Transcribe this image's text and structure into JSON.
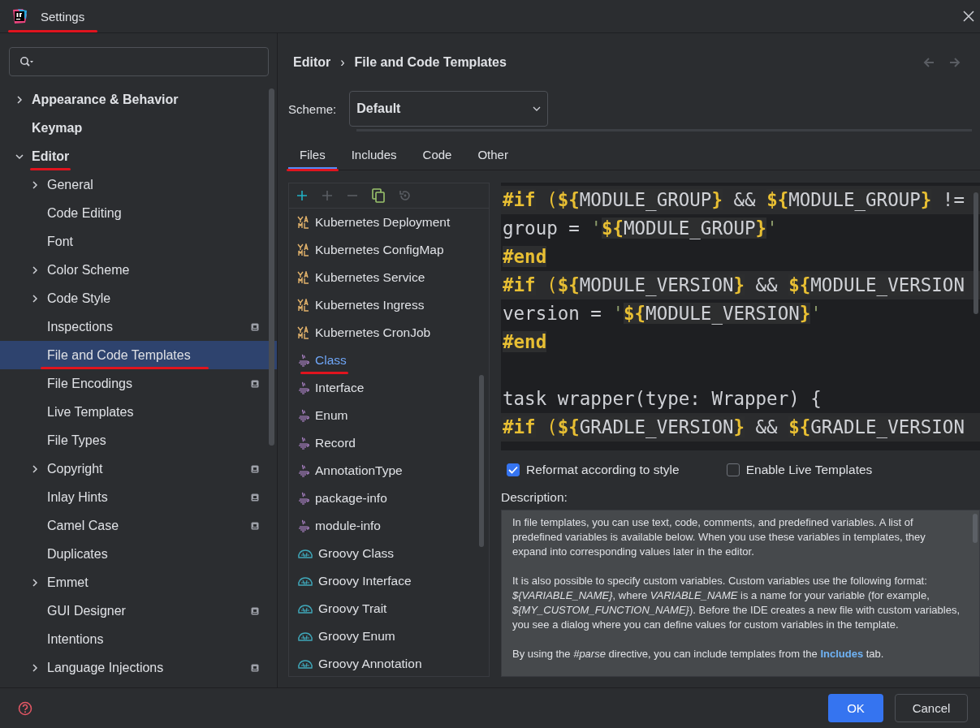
{
  "window": {
    "title": "Settings",
    "title_annotated": true
  },
  "sidebar": {
    "items": [
      {
        "label": "Appearance & Behavior",
        "expanded": false,
        "selected": false
      },
      {
        "label": "Keymap",
        "selected": false
      },
      {
        "label": "Editor",
        "expanded": true,
        "selected": false,
        "annotated": true,
        "children": [
          {
            "label": "General",
            "expanded": false,
            "selected": false
          },
          {
            "label": "Code Editing",
            "selected": false
          },
          {
            "label": "Font",
            "selected": false
          },
          {
            "label": "Color Scheme",
            "expanded": false,
            "selected": false
          },
          {
            "label": "Code Style",
            "expanded": false,
            "selected": false
          },
          {
            "label": "Inspections",
            "selected": false,
            "scoped": true
          },
          {
            "label": "File and Code Templates",
            "selected": true,
            "annotated": true
          },
          {
            "label": "File Encodings",
            "selected": false,
            "scoped": true
          },
          {
            "label": "Live Templates",
            "selected": false
          },
          {
            "label": "File Types",
            "selected": false
          },
          {
            "label": "Copyright",
            "expanded": false,
            "selected": false,
            "scoped": true
          },
          {
            "label": "Inlay Hints",
            "selected": false,
            "scoped": true
          },
          {
            "label": "Camel Case",
            "selected": false,
            "scoped": true
          },
          {
            "label": "Duplicates",
            "selected": false
          },
          {
            "label": "Emmet",
            "expanded": false,
            "selected": false
          },
          {
            "label": "GUI Designer",
            "selected": false,
            "scoped": true
          },
          {
            "label": "Intentions",
            "selected": false
          },
          {
            "label": "Language Injections",
            "expanded": false,
            "selected": false,
            "scoped": true
          }
        ]
      }
    ]
  },
  "breadcrumb": {
    "parent": "Editor",
    "separator": "›",
    "current": "File and Code Templates"
  },
  "scheme": {
    "label": "Scheme:",
    "value": "Default"
  },
  "tabs": [
    {
      "label": "Files",
      "selected": true,
      "annotated": true
    },
    {
      "label": "Includes",
      "selected": false
    },
    {
      "label": "Code",
      "selected": false
    },
    {
      "label": "Other",
      "selected": false
    }
  ],
  "templates": [
    {
      "label": "Kubernetes Deployment",
      "kind": "yaml",
      "selected": false
    },
    {
      "label": "Kubernetes ConfigMap",
      "kind": "yaml",
      "selected": false
    },
    {
      "label": "Kubernetes Service",
      "kind": "yaml",
      "selected": false
    },
    {
      "label": "Kubernetes Ingress",
      "kind": "yaml",
      "selected": false
    },
    {
      "label": "Kubernetes CronJob",
      "kind": "yaml",
      "selected": false
    },
    {
      "label": "Class",
      "kind": "java",
      "selected": true,
      "annotated": true
    },
    {
      "label": "Interface",
      "kind": "java",
      "selected": false
    },
    {
      "label": "Enum",
      "kind": "java",
      "selected": false
    },
    {
      "label": "Record",
      "kind": "java",
      "selected": false
    },
    {
      "label": "AnnotationType",
      "kind": "java",
      "selected": false
    },
    {
      "label": "package-info",
      "kind": "java",
      "selected": false
    },
    {
      "label": "module-info",
      "kind": "java",
      "selected": false
    },
    {
      "label": "Groovy Class",
      "kind": "groovy",
      "selected": false
    },
    {
      "label": "Groovy Interface",
      "kind": "groovy",
      "selected": false
    },
    {
      "label": "Groovy Trait",
      "kind": "groovy",
      "selected": false
    },
    {
      "label": "Groovy Enum",
      "kind": "groovy",
      "selected": false
    },
    {
      "label": "Groovy Annotation",
      "kind": "groovy",
      "selected": false
    }
  ],
  "code_lines": [
    {
      "kind": "code",
      "highlighted": true,
      "segments": [
        {
          "t": "#if",
          "kind": "directive"
        },
        {
          "t": " (",
          "kind": "paren"
        },
        {
          "t": "${",
          "kind": "brace"
        },
        {
          "t": "MODULE_GROUP",
          "kind": "name"
        },
        {
          "t": "}",
          "kind": "brace"
        },
        {
          "t": " && ",
          "kind": "plain"
        },
        {
          "t": "${",
          "kind": "brace"
        },
        {
          "t": "MODULE_GROUP",
          "kind": "name"
        },
        {
          "t": "}",
          "kind": "brace"
        },
        {
          "t": " !=",
          "kind": "plain"
        }
      ]
    },
    {
      "kind": "code",
      "highlighted": false,
      "segments": [
        {
          "t": "group = ",
          "kind": "plain"
        },
        {
          "t": "'",
          "kind": "quote"
        },
        {
          "t": "${",
          "kind": "brace"
        },
        {
          "t": "MODULE_GROUP",
          "kind": "name"
        },
        {
          "t": "}",
          "kind": "brace"
        },
        {
          "t": "'",
          "kind": "quote"
        }
      ]
    },
    {
      "kind": "code",
      "highlighted": false,
      "segments": [
        {
          "t": "#end",
          "kind": "directive"
        }
      ]
    },
    {
      "kind": "code",
      "highlighted": true,
      "segments": [
        {
          "t": "#if",
          "kind": "directive"
        },
        {
          "t": " (",
          "kind": "paren"
        },
        {
          "t": "${",
          "kind": "brace"
        },
        {
          "t": "MODULE_VERSION",
          "kind": "name"
        },
        {
          "t": "}",
          "kind": "brace"
        },
        {
          "t": " && ",
          "kind": "plain"
        },
        {
          "t": "${",
          "kind": "brace"
        },
        {
          "t": "MODULE_VERSION",
          "kind": "name"
        }
      ]
    },
    {
      "kind": "code",
      "highlighted": false,
      "segments": [
        {
          "t": "version = ",
          "kind": "plain"
        },
        {
          "t": "'",
          "kind": "quote"
        },
        {
          "t": "${",
          "kind": "brace"
        },
        {
          "t": "MODULE_VERSION",
          "kind": "name"
        },
        {
          "t": "}",
          "kind": "brace"
        },
        {
          "t": "'",
          "kind": "quote"
        }
      ]
    },
    {
      "kind": "code",
      "highlighted": false,
      "segments": [
        {
          "t": "#end",
          "kind": "directive"
        }
      ]
    },
    {
      "kind": "blank"
    },
    {
      "kind": "code",
      "highlighted": false,
      "segments": [
        {
          "t": "task wrapper(type: Wrapper) {",
          "kind": "plain"
        }
      ]
    },
    {
      "kind": "code",
      "highlighted": true,
      "segments": [
        {
          "t": "#if",
          "kind": "directive"
        },
        {
          "t": " (",
          "kind": "paren"
        },
        {
          "t": "${",
          "kind": "brace"
        },
        {
          "t": "GRADLE_VERSION",
          "kind": "name"
        },
        {
          "t": "}",
          "kind": "brace"
        },
        {
          "t": " && ",
          "kind": "plain"
        },
        {
          "t": "${",
          "kind": "brace"
        },
        {
          "t": "GRADLE_VERSION",
          "kind": "name"
        }
      ]
    }
  ],
  "options": [
    {
      "label": "Reformat according to style",
      "checked": true
    },
    {
      "label": "Enable Live Templates",
      "checked": false
    }
  ],
  "description": {
    "label": "Description:",
    "paragraphs": [
      {
        "text": "In file templates, you can use text, code, comments, and predefined variables. A list of predefined variables is available below. When you use these variables in templates, they expand into corresponding values later in the editor."
      },
      {
        "text": "It is also possible to specify custom variables. Custom variables use the following format: *${VARIABLE_NAME}*, where *VARIABLE_NAME* is a name for your variable (for example, *${MY_CUSTOM_FUNCTION_NAME}*). Before the IDE creates a new file with custom variables, you see a dialog where you can define values for custom variables in the template."
      },
      {
        "text": "By using the *#parse* directive, you can include templates from the",
        "link": "Includes",
        "after": " tab."
      }
    ]
  },
  "buttons": [
    {
      "label": "OK",
      "kind": "primary"
    },
    {
      "label": "Cancel",
      "kind": "secondary"
    }
  ]
}
